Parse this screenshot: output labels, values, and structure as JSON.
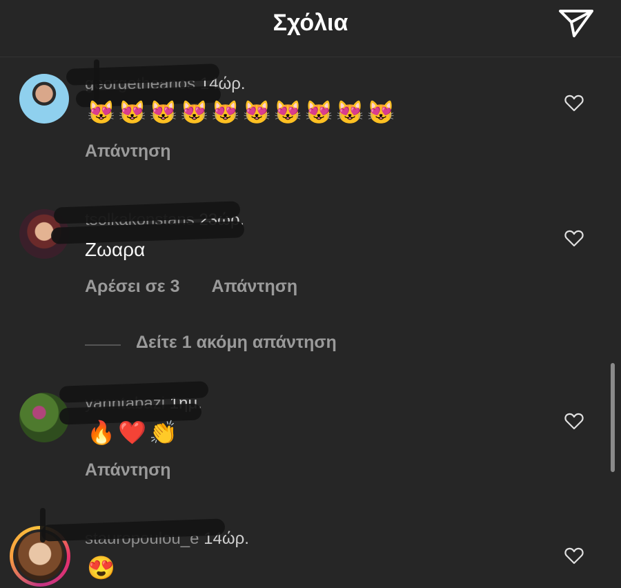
{
  "header": {
    "title": "Σχόλια",
    "icon": "send-icon"
  },
  "comments": [
    {
      "username": "georgetheanos",
      "time": "14ώρ.",
      "emoji": "😻😻😻😻😻😻😻😻😻😻",
      "actions": {
        "reply": "Απάντηση"
      }
    },
    {
      "username": "tsolkakonstans",
      "time": "23ώρ.",
      "text": "Ζωαρα",
      "actions": {
        "likes": "Αρέσει σε 3",
        "reply": "Απάντηση"
      },
      "more_replies": "Δείτε 1 ακόμη απάντηση"
    },
    {
      "username": "yanntabazi",
      "time": "1ημ.",
      "emoji": "🔥❤️👏",
      "actions": {
        "reply": "Απάντηση"
      }
    },
    {
      "username": "stauropoulou_e",
      "time": "14ώρ.",
      "emoji": "😍"
    }
  ],
  "colors": {
    "background": "#262626",
    "muted_text": "#9a9a9a",
    "story_ring": "#e8316b"
  }
}
